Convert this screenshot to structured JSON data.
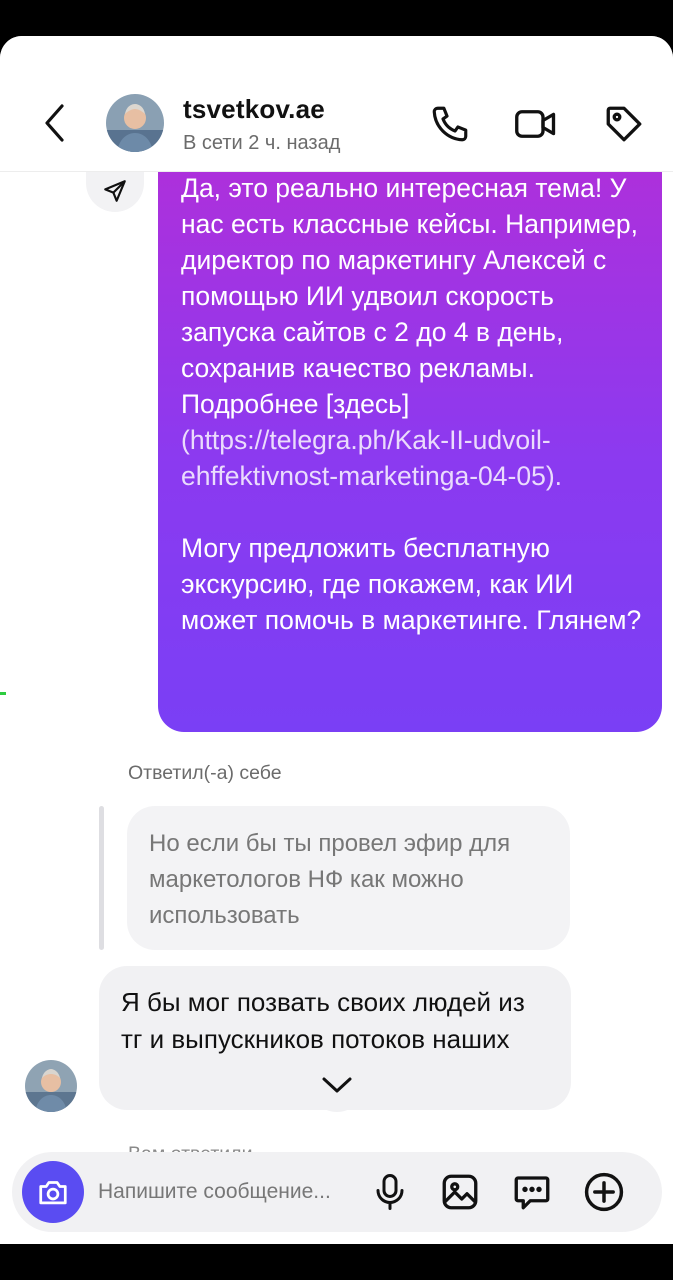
{
  "header": {
    "username": "tsvetkov.ae",
    "status": "В сети 2 ч. назад",
    "icons": [
      "back-arrow-icon",
      "phone-icon",
      "video-call-icon",
      "tag-icon"
    ]
  },
  "messages": {
    "outgoing": {
      "part1": "Да, это реально интересная тема! У нас есть классные кейсы. Например, директор по маркетингу Алексей с помощью ИИ удвоил скорость запуска сайтов с 2 до 4 в день, сохранив качество рекламы. Подробнее [здесь]",
      "link": "(https://telegra.ph/Kak-II-udvoil-ehffektivnost-marketinga-04-05).",
      "part2": "Могу предложить бесплатную экскурсию, где покажем, как ИИ может помочь в маркетинге. Глянем?"
    },
    "replied_label": "Ответил(-а) себе",
    "quote": "Но если бы ты провел эфир для маркетологов НФ как можно использовать",
    "incoming": "Я бы мог позвать своих людей из тг и выпускников потоков наших",
    "peek_label": "Вам ответили"
  },
  "composer": {
    "placeholder": "Напишите сообщение...",
    "icons": [
      "camera-icon",
      "microphone-icon",
      "gallery-icon",
      "sticker-icon",
      "plus-icon"
    ],
    "accent_color": "#5a4cf2"
  },
  "colors": {
    "bubble_gradient_top": "#b12fd9",
    "bubble_gradient_bottom": "#7a3ff5"
  }
}
